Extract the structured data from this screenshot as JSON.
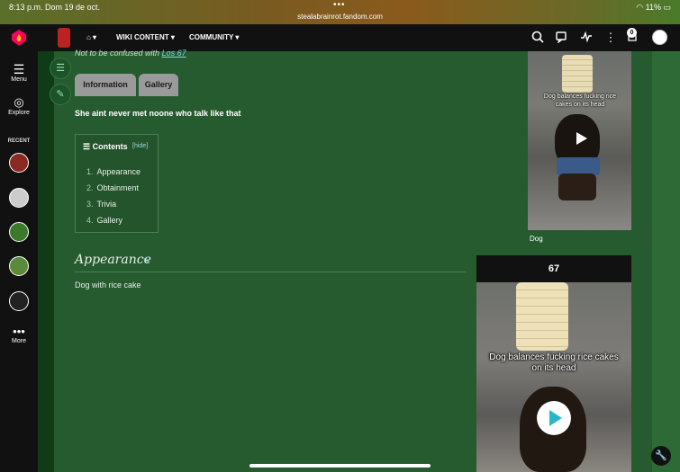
{
  "status_bar": {
    "time": "8:13 p.m.",
    "date": "Dom 19 de oct.",
    "url": "stealabrainrot.fandom.com",
    "battery": "11%"
  },
  "top_nav": {
    "wiki_content": "WIKI CONTENT",
    "community": "COMMUNITY",
    "notification_count": "0"
  },
  "left_rail": {
    "menu_label": "Menu",
    "explore_label": "Explore",
    "recent_label": "RECENT",
    "more_label": "More"
  },
  "article": {
    "note_prefix": "Not to be confused with",
    "note_link": "Los 67",
    "tabs": [
      "Information",
      "Gallery"
    ],
    "quote": "She aint never met noone who talk like that",
    "toc": {
      "title": "Contents",
      "hide": "hide",
      "items": [
        {
          "num": "1.",
          "label": "Appearance"
        },
        {
          "num": "2.",
          "label": "Obtainment"
        },
        {
          "num": "3.",
          "label": "Trivia"
        },
        {
          "num": "4.",
          "label": "Gallery"
        }
      ]
    },
    "section_title": "Appearance",
    "section_body": "Dog with rice cake"
  },
  "infobox": {
    "video_caption": "Dog balances fucking rice cakes on its head",
    "image_caption": "Dog",
    "card_title": "67",
    "card_video_caption": "Dog balances fucking rice cakes on its head"
  }
}
